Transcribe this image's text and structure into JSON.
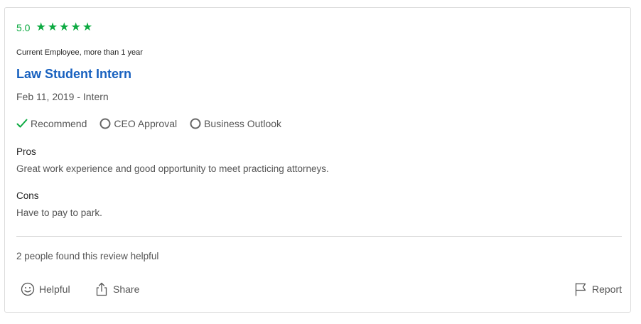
{
  "review": {
    "rating": "5.0",
    "stars": 5,
    "employee_status": "Current Employee, more than 1 year",
    "title": "Law Student Intern",
    "date_role": "Feb 11, 2019 - Intern",
    "badges": {
      "recommend": "Recommend",
      "ceo_approval": "CEO Approval",
      "business_outlook": "Business Outlook"
    },
    "pros_label": "Pros",
    "pros_text": "Great work experience and good opportunity to meet practicing attorneys.",
    "cons_label": "Cons",
    "cons_text": "Have to pay to park.",
    "helpful_count_text": "2 people found this review helpful"
  },
  "actions": {
    "helpful": "Helpful",
    "share": "Share",
    "report": "Report"
  },
  "colors": {
    "accent_green": "#0caa41",
    "title_blue": "#1861bf",
    "icon_gray": "#555555"
  }
}
